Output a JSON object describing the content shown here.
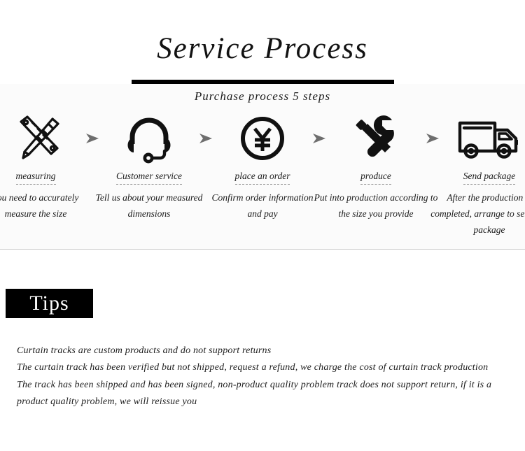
{
  "header": {
    "title": "Service Process"
  },
  "process": {
    "subtitle": "Purchase process 5 steps",
    "steps": [
      {
        "icon": "ruler-pencil-icon",
        "title": "measuring",
        "desc": "You need to accurately measure the size"
      },
      {
        "icon": "headset-icon",
        "title": "Customer service",
        "desc": "Tell us about your measured dimensions"
      },
      {
        "icon": "yen-circle-icon",
        "title": "place an order",
        "desc": "Confirm order information and pay"
      },
      {
        "icon": "wrench-screwdriver-icon",
        "title": "produce",
        "desc": "Put into production according to the size you provide"
      },
      {
        "icon": "delivery-truck-icon",
        "title": "Send package",
        "desc": "After the production is completed, arrange to send the package"
      }
    ],
    "arrow_icon": "arrow-right-icon"
  },
  "tips": {
    "badge": "Tips",
    "lines": [
      "Curtain tracks are custom products and do not support returns",
      "The curtain track has been verified but not shipped, request a refund, we charge the cost of curtain track production",
      "The track has been shipped and has been signed, non-product quality problem track does not support return, if it is a product quality problem, we will reissue you"
    ]
  },
  "colors": {
    "ink": "#121212",
    "badge_bg": "#000000",
    "badge_fg": "#ffffff",
    "arrow": "#6e6e6e",
    "panel_bg": "#fbfbfb"
  }
}
